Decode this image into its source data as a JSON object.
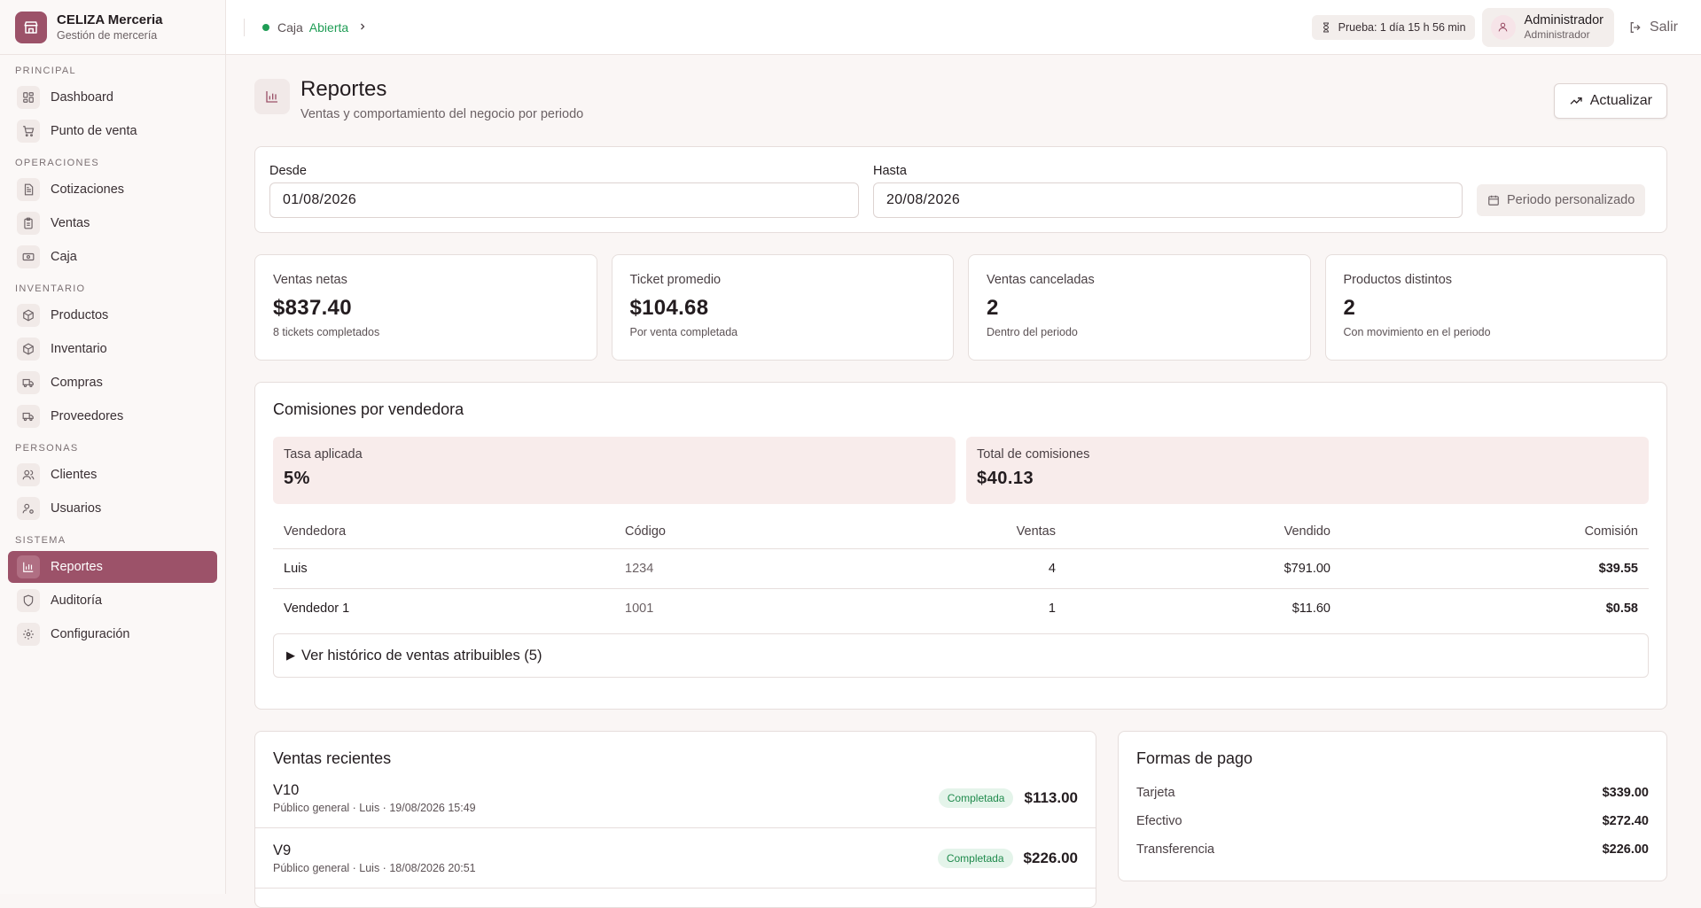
{
  "brand": {
    "name": "CELIZA Merceria",
    "subtitle": "Gestión de mercería"
  },
  "sidebar": {
    "sections": [
      {
        "label": "PRINCIPAL",
        "items": [
          {
            "label": "Dashboard",
            "icon": "dashboard-icon"
          },
          {
            "label": "Punto de venta",
            "icon": "cart-icon"
          }
        ]
      },
      {
        "label": "OPERACIONES",
        "items": [
          {
            "label": "Cotizaciones",
            "icon": "document-icon"
          },
          {
            "label": "Ventas",
            "icon": "clipboard-icon"
          },
          {
            "label": "Caja",
            "icon": "cash-icon"
          }
        ]
      },
      {
        "label": "INVENTARIO",
        "items": [
          {
            "label": "Productos",
            "icon": "box-icon"
          },
          {
            "label": "Inventario",
            "icon": "box-icon"
          },
          {
            "label": "Compras",
            "icon": "truck-icon"
          },
          {
            "label": "Proveedores",
            "icon": "truck-icon"
          }
        ]
      },
      {
        "label": "PERSONAS",
        "items": [
          {
            "label": "Clientes",
            "icon": "users-icon"
          },
          {
            "label": "Usuarios",
            "icon": "user-gear-icon"
          }
        ]
      },
      {
        "label": "SISTEMA",
        "items": [
          {
            "label": "Reportes",
            "icon": "chart-icon",
            "active": true
          },
          {
            "label": "Auditoría",
            "icon": "shield-icon"
          },
          {
            "label": "Configuración",
            "icon": "gear-icon"
          }
        ]
      }
    ]
  },
  "topbar": {
    "cash_label": "Caja",
    "cash_status": "Abierta",
    "trial": "Prueba: 1 día 15 h 56 min",
    "user_name": "Administrador",
    "user_role": "Administrador",
    "logout": "Salir"
  },
  "page": {
    "title": "Reportes",
    "subtitle": "Ventas y comportamiento del negocio por periodo",
    "refresh_label": "Actualizar"
  },
  "filters": {
    "from_label": "Desde",
    "from_value": "01/08/2026",
    "to_label": "Hasta",
    "to_value": "20/08/2026",
    "period_label": "Periodo personalizado"
  },
  "kpis": [
    {
      "label": "Ventas netas",
      "value": "$837.40",
      "hint": "8 tickets completados"
    },
    {
      "label": "Ticket promedio",
      "value": "$104.68",
      "hint": "Por venta completada"
    },
    {
      "label": "Ventas canceladas",
      "value": "2",
      "hint": "Dentro del periodo"
    },
    {
      "label": "Productos distintos",
      "value": "2",
      "hint": "Con movimiento en el periodo"
    }
  ],
  "commissions": {
    "title": "Comisiones por vendedora",
    "rate_label": "Tasa aplicada",
    "rate_value": "5%",
    "total_label": "Total de comisiones",
    "total_value": "$40.13",
    "columns": {
      "seller": "Vendedora",
      "code": "Código",
      "sales": "Ventas",
      "sold": "Vendido",
      "commission": "Comisión"
    },
    "rows": [
      {
        "seller": "Luis",
        "code": "1234",
        "sales": "4",
        "sold": "$791.00",
        "commission": "$39.55"
      },
      {
        "seller": "Vendedor 1",
        "code": "1001",
        "sales": "1",
        "sold": "$11.60",
        "commission": "$0.58"
      }
    ],
    "history_label": "Ver histórico de ventas atribuibles (5)"
  },
  "recent": {
    "title": "Ventas recientes",
    "items": [
      {
        "id": "V10",
        "meta": "Público general · Luis · 19/08/2026 15:49",
        "status": "Completada",
        "amount": "$113.00"
      },
      {
        "id": "V9",
        "meta": "Público general · Luis · 18/08/2026 20:51",
        "status": "Completada",
        "amount": "$226.00"
      }
    ]
  },
  "payments": {
    "title": "Formas de pago",
    "items": [
      {
        "label": "Tarjeta",
        "amount": "$339.00"
      },
      {
        "label": "Efectivo",
        "amount": "$272.40"
      },
      {
        "label": "Transferencia",
        "amount": "$226.00"
      }
    ]
  },
  "colors": {
    "accent": "#9c5269",
    "success": "#1f9d55",
    "background": "#faf6f5"
  }
}
